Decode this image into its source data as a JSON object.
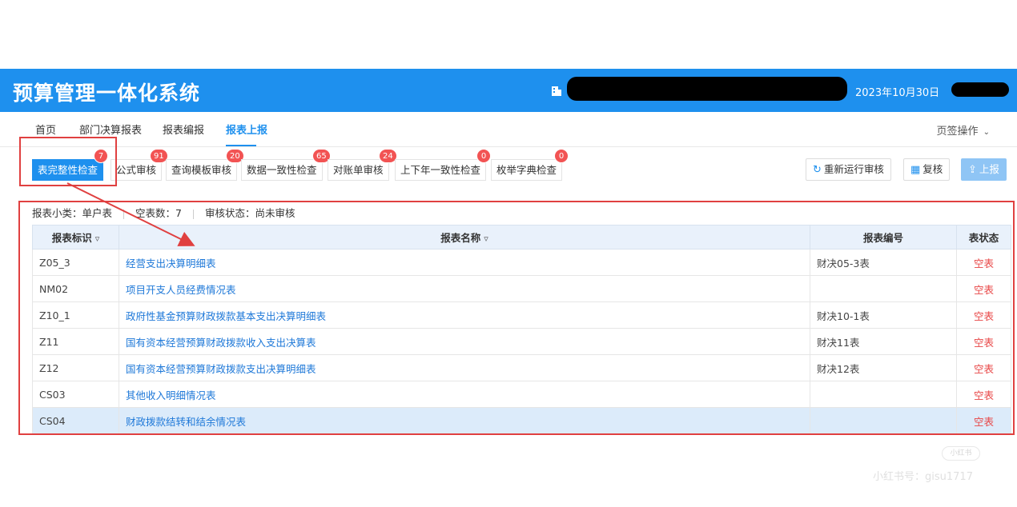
{
  "header": {
    "title": "预算管理一体化系统",
    "date": "2023年10月30日"
  },
  "nav": {
    "items": [
      {
        "label": "首页"
      },
      {
        "label": "部门决算报表"
      },
      {
        "label": "报表编报"
      },
      {
        "label": "报表上报",
        "active": true
      }
    ],
    "tab_ops": "页签操作"
  },
  "checks": [
    {
      "label": "表完整性检查",
      "count": "7",
      "active": true
    },
    {
      "label": "公式审核",
      "count": "91"
    },
    {
      "label": "查询模板审核",
      "count": "20"
    },
    {
      "label": "数据一致性检查",
      "count": "65"
    },
    {
      "label": "对账单审核",
      "count": "24"
    },
    {
      "label": "上下年一致性检查",
      "count": "0"
    },
    {
      "label": "枚举字典检查",
      "count": "0"
    }
  ],
  "actions": {
    "rerun": "重新运行审核",
    "recheck": "复核",
    "submit": "上报"
  },
  "info": {
    "subclass_label": "报表小类：",
    "subclass_value": "单户表",
    "empty_label": "空表数：",
    "empty_value": "7",
    "status_label": "审核状态：",
    "status_value": "尚未审核"
  },
  "table": {
    "columns": [
      "报表标识",
      "报表名称",
      "报表编号",
      "表状态"
    ],
    "rows": [
      {
        "id": "Z05_3",
        "name": "经营支出决算明细表",
        "code": "财决05-3表",
        "status": "空表"
      },
      {
        "id": "NM02",
        "name": "项目开支人员经费情况表",
        "code": "",
        "status": "空表"
      },
      {
        "id": "Z10_1",
        "name": "政府性基金预算财政拨款基本支出决算明细表",
        "code": "财决10-1表",
        "status": "空表"
      },
      {
        "id": "Z11",
        "name": "国有资本经营预算财政拨款收入支出决算表",
        "code": "财决11表",
        "status": "空表"
      },
      {
        "id": "Z12",
        "name": "国有资本经营预算财政拨款支出决算明细表",
        "code": "财决12表",
        "status": "空表"
      },
      {
        "id": "CS03",
        "name": "其他收入明细情况表",
        "code": "",
        "status": "空表"
      },
      {
        "id": "CS04",
        "name": "财政拨款结转和结余情况表",
        "code": "",
        "status": "空表",
        "selected": true
      }
    ]
  },
  "watermark": {
    "badge": "小红书",
    "text": "小红书号：gisu1717"
  },
  "colors": {
    "brand": "#1e90ee",
    "badge": "#f25353",
    "annotation": "#e04040",
    "status_empty": "#e84545"
  }
}
